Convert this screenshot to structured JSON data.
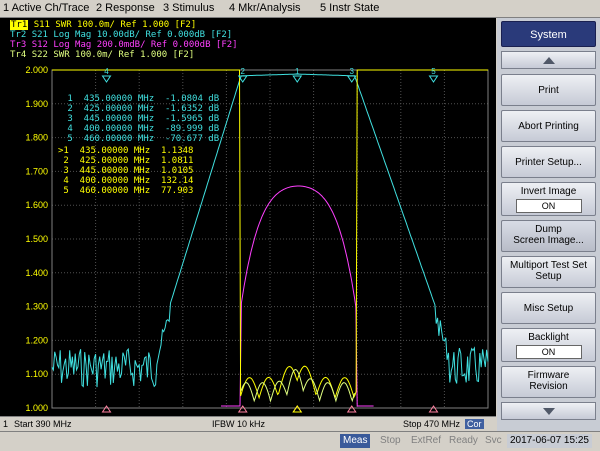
{
  "menu": [
    "1 Active Ch/Trace",
    "2 Response",
    "3 Stimulus",
    "4 Mkr/Analysis",
    "5 Instr State"
  ],
  "traces": [
    {
      "id": "Tr1",
      "param": "S11",
      "text": "SWR 100.0m/ Ref 1.000 [F2]",
      "color": "#ffff00"
    },
    {
      "id": "Tr2",
      "param": "S21",
      "text": "Log Mag 10.00dB/ Ref 0.000dB [F2]",
      "color": "#40e0e0"
    },
    {
      "id": "Tr3",
      "param": "S12",
      "text": "Log Mag 200.0mdB/ Ref 0.000dB [F2]",
      "color": "#ff40ff"
    },
    {
      "id": "Tr4",
      "param": "S22",
      "text": "SWR 100.0m/ Ref 1.000 [F2]",
      "color": "#40e0a0"
    }
  ],
  "y_axis_labels": [
    "2.000",
    "1.900",
    "1.800",
    "1.700",
    "1.600",
    "1.500",
    "1.400",
    "1.300",
    "1.200",
    "1.100",
    "1.000"
  ],
  "marker_table_s21": [
    {
      "n": "1",
      "freq": "435.00000 MHz",
      "val": "-1.0804 dB"
    },
    {
      "n": "2",
      "freq": "425.00000 MHz",
      "val": "-1.6352 dB"
    },
    {
      "n": "3",
      "freq": "445.00000 MHz",
      "val": "-1.5965 dB"
    },
    {
      "n": "4",
      "freq": "400.00000 MHz",
      "val": "-89.999 dB"
    },
    {
      "n": "5",
      "freq": "460.00000 MHz",
      "val": "-70.677 dB"
    }
  ],
  "marker_table_s11": [
    {
      "n": ">1",
      "freq": "435.00000 MHz",
      "val": "1.1348"
    },
    {
      "n": "2",
      "freq": "425.00000 MHz",
      "val": "1.0811"
    },
    {
      "n": "3",
      "freq": "445.00000 MHz",
      "val": "1.0105"
    },
    {
      "n": "4",
      "freq": "400.00000 MHz",
      "val": "132.14"
    },
    {
      "n": "5",
      "freq": "460.00000 MHz",
      "val": "77.903"
    }
  ],
  "status": {
    "channel": "1",
    "start": "Start 390 MHz",
    "ifbw": "IFBW 10 kHz",
    "stop": "Stop 470 MHz",
    "cor": "Cor"
  },
  "bottom": {
    "meas": "Meas",
    "stop": "Stop",
    "extref": "ExtRef",
    "ready": "Ready",
    "svc": "Svc",
    "datetime": "2017-06-07 15:25"
  },
  "softkeys": {
    "title": "System",
    "print": "Print",
    "abort": "Abort Printing",
    "printer_setup": "Printer Setup...",
    "invert_image": "Invert Image",
    "invert_val": "ON",
    "dump_line1": "Dump",
    "dump_line2": "Screen Image...",
    "multiport_line1": "Multiport Test Set",
    "multiport_line2": "Setup",
    "misc_setup": "Misc Setup",
    "backlight": "Backlight",
    "backlight_val": "ON",
    "firmware_line1": "Firmware",
    "firmware_line2": "Revision"
  },
  "colors": {
    "s21": "#40e0e0",
    "s11": "#ffff00",
    "s12": "#ff40ff",
    "s22": "#40e0a0",
    "marker_pink": "#ff80a0"
  }
}
